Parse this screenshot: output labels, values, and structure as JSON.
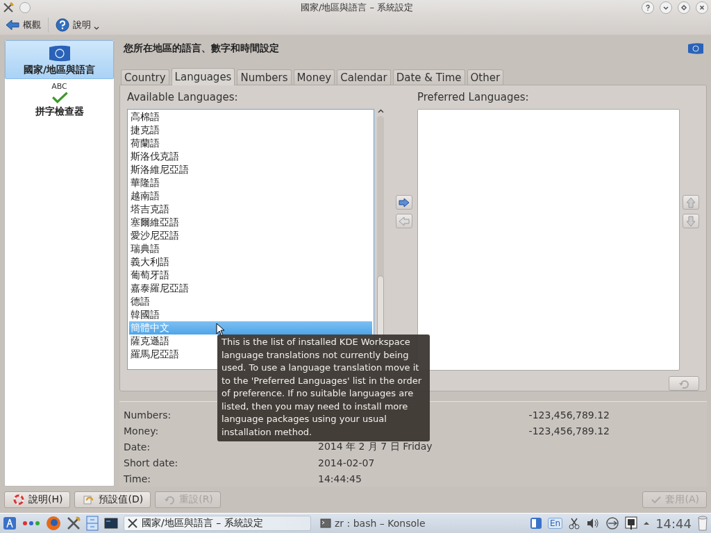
{
  "window": {
    "title": "國家/地區與語言 – 系統設定"
  },
  "toolbar": [
    {
      "kind": "back",
      "label": "概觀"
    },
    {
      "kind": "help",
      "label": "說明"
    }
  ],
  "sidebar": {
    "items": [
      {
        "kind": "flag",
        "label": "國家/地區與語言",
        "selected": true
      },
      {
        "kind": "spell",
        "icon_text": "ABC",
        "label": "拼字檢查器",
        "selected": false
      }
    ]
  },
  "page_title": "您所在地區的語言、數字和時間設定",
  "tabs": [
    {
      "label": "Country",
      "selected": false
    },
    {
      "label": "Languages",
      "selected": true
    },
    {
      "label": "Numbers",
      "selected": false
    },
    {
      "label": "Money",
      "selected": false
    },
    {
      "label": "Calendar",
      "selected": false
    },
    {
      "label": "Date & Time",
      "selected": false
    },
    {
      "label": "Other",
      "selected": false
    }
  ],
  "available_languages": {
    "label": "Available Languages:",
    "items": [
      {
        "label": "高棉語",
        "selected": false
      },
      {
        "label": "捷克語",
        "selected": false
      },
      {
        "label": "荷蘭語",
        "selected": false
      },
      {
        "label": "斯洛伐克語",
        "selected": false
      },
      {
        "label": "斯洛維尼亞語",
        "selected": false
      },
      {
        "label": "華隆語",
        "selected": false
      },
      {
        "label": "越南語",
        "selected": false
      },
      {
        "label": "塔吉克語",
        "selected": false
      },
      {
        "label": "塞爾維亞語",
        "selected": false
      },
      {
        "label": "愛沙尼亞語",
        "selected": false
      },
      {
        "label": "瑞典語",
        "selected": false
      },
      {
        "label": "義大利語",
        "selected": false
      },
      {
        "label": "葡萄牙語",
        "selected": false
      },
      {
        "label": "嘉泰羅尼亞語",
        "selected": false
      },
      {
        "label": "德語",
        "selected": false
      },
      {
        "label": "韓國語",
        "selected": false
      },
      {
        "label": "簡體中文",
        "selected": true
      },
      {
        "label": "薩克遜語",
        "selected": false
      },
      {
        "label": "羅馬尼亞語",
        "selected": false
      }
    ]
  },
  "preferred_languages": {
    "label": "Preferred Languages:"
  },
  "tooltip": {
    "text": "This is the list of installed KDE Workspace language translations not currently being used. To use a language translation move it to the 'Preferred Languages' list in the order of preference. If no suitable languages are listed, then you may need to install more language packages using your usual installation method."
  },
  "preview": [
    {
      "label": "Numbers:",
      "value_2": "-123,456,789.12"
    },
    {
      "label": "Money:",
      "value_2": "-123,456,789.12"
    },
    {
      "label": "Date:",
      "value": "2014 年 2 月 7 日 Friday"
    },
    {
      "label": "Short date:",
      "value": "2014-02-07"
    },
    {
      "label": "Time:",
      "value": "14:44:45"
    }
  ],
  "buttons": [
    {
      "kind": "help",
      "label": "說明(H)",
      "disabled": false
    },
    {
      "kind": "defaults",
      "label": "預設值(D)",
      "disabled": false
    },
    {
      "kind": "reset",
      "label": "重設(R)",
      "disabled": true
    },
    {
      "kind": "apply",
      "label": "套用(A)",
      "disabled": true
    }
  ],
  "taskbar": {
    "tasks": [
      {
        "kind": "settings",
        "label": "國家/地區與語言 – 系統設定",
        "active": true
      },
      {
        "kind": "terminal",
        "label": "zr : bash – Konsole",
        "active": false
      }
    ],
    "keyboard_layout": "En",
    "clock": "14:44"
  }
}
